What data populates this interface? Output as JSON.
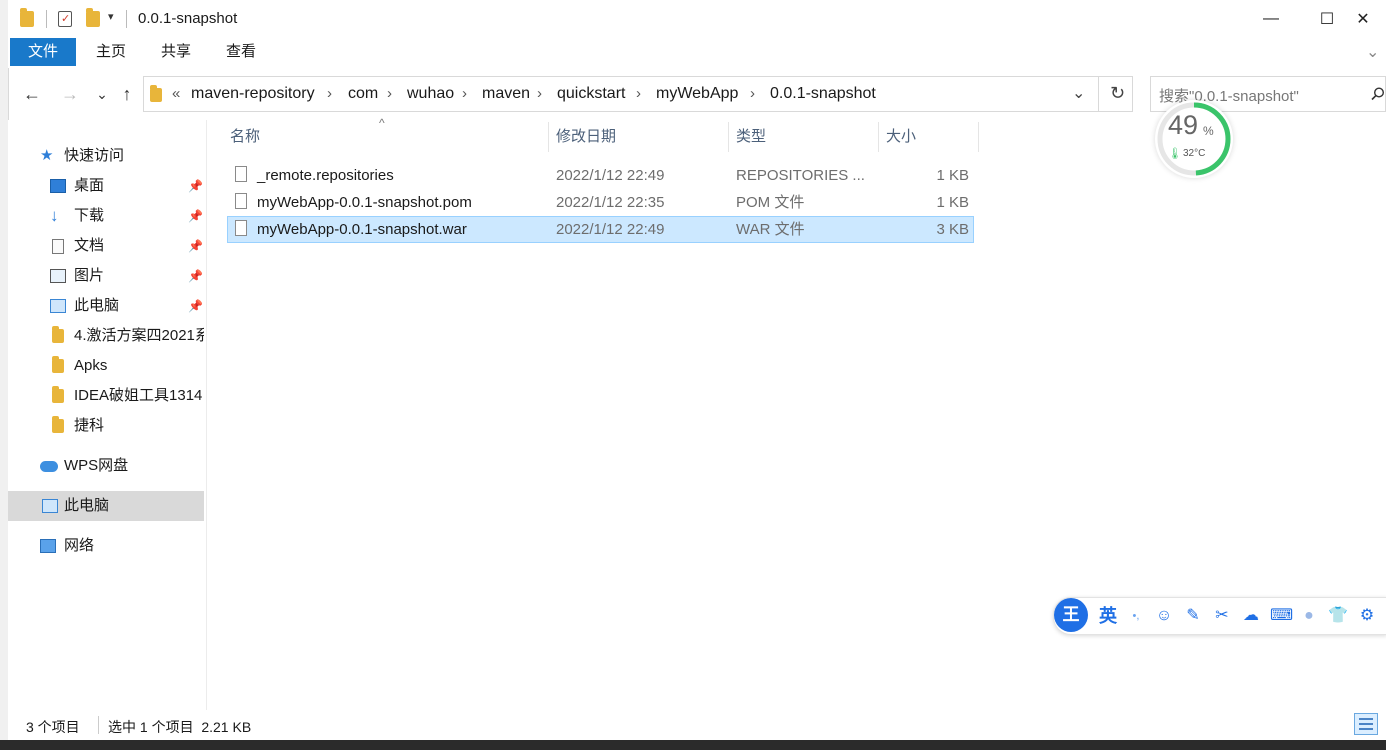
{
  "window": {
    "title": "0.0.1-snapshot",
    "minimize": "—",
    "maximize": "☐",
    "close": "✕"
  },
  "ribbon": {
    "tabs": [
      "文件",
      "主页",
      "共享",
      "查看"
    ],
    "collapse_icon": "chevron-down-icon"
  },
  "nav": {
    "back": "←",
    "forward": "→",
    "recent": "⌄",
    "up": "↑"
  },
  "address": {
    "overflow": "«",
    "crumbs": [
      "maven-repository",
      "com",
      "wuhao",
      "maven",
      "quickstart",
      "myWebApp",
      "0.0.1-snapshot"
    ],
    "separator": "›",
    "dropdown": "⌄",
    "refresh": "↻"
  },
  "search": {
    "placeholder": "搜索\"0.0.1-snapshot\""
  },
  "navpane": {
    "quick_access": "快速访问",
    "pinned": [
      {
        "label": "桌面",
        "icon": "desktop-icon"
      },
      {
        "label": "下载",
        "icon": "download-icon"
      },
      {
        "label": "文档",
        "icon": "document-icon"
      },
      {
        "label": "图片",
        "icon": "pictures-icon"
      },
      {
        "label": "此电脑",
        "icon": "computer-icon"
      }
    ],
    "folders": [
      "4.激活方案四2021系",
      "Apks",
      "IDEA破姐工具1314",
      "捷科"
    ],
    "wps": "WPS网盘",
    "this_pc": "此电脑",
    "network": "网络"
  },
  "columns": {
    "name": "名称",
    "modified": "修改日期",
    "type": "类型",
    "size": "大小",
    "sort_indicator": "^"
  },
  "files": [
    {
      "name": "_remote.repositories",
      "modified": "2022/1/12 22:49",
      "type": "REPOSITORIES ...",
      "size": "1 KB",
      "selected": false
    },
    {
      "name": "myWebApp-0.0.1-snapshot.pom",
      "modified": "2022/1/12 22:35",
      "type": "POM 文件",
      "size": "1 KB",
      "selected": false
    },
    {
      "name": "myWebApp-0.0.1-snapshot.war",
      "modified": "2022/1/12 22:49",
      "type": "WAR 文件",
      "size": "3 KB",
      "selected": true
    }
  ],
  "status": {
    "count": "3 个项目",
    "selection": "选中 1 个项目  2.21 KB"
  },
  "perf_widget": {
    "percent": "49",
    "percent_sign": "%",
    "temp": "32°C",
    "ring_color": "#3ac46a",
    "ring_fraction": 0.49
  },
  "ime": {
    "logo": "王",
    "lang": "英",
    "punct": "•,",
    "icons": [
      "emoji-icon",
      "pen-icon",
      "scissors-icon",
      "cloud-icon",
      "keyboard-icon",
      "user-icon",
      "shirt-icon",
      "settings-icon"
    ]
  },
  "colors": {
    "accent": "#1979ca",
    "selection_bg": "#cce8ff",
    "selection_border": "#99d1ff"
  }
}
